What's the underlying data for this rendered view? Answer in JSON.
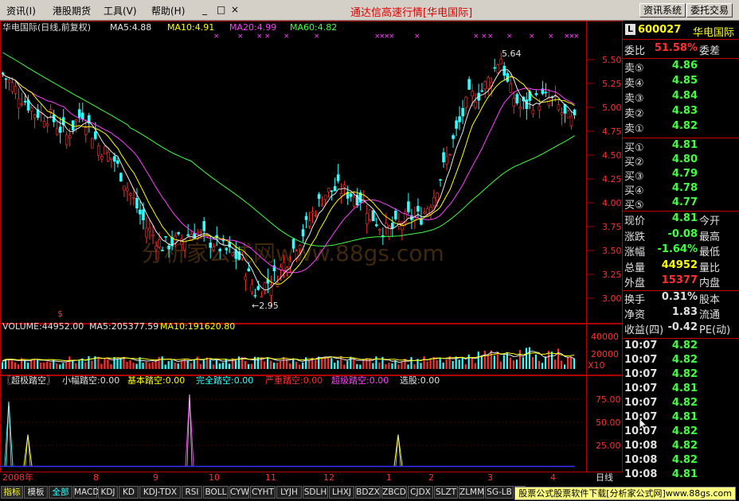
{
  "menubar": {
    "items": [
      "资讯(I)",
      "港股期货",
      "工具(V)",
      "帮助(H)",
      "_",
      "□",
      "×"
    ],
    "title": "通达信高速行情[华电国际]",
    "buttons": [
      "资讯系统",
      "委托交易"
    ]
  },
  "chart_header": {
    "name": "华电国际(日线,前复权)",
    "ma5": "MA5:4.88",
    "ma10": "MA10:4.91",
    "ma20": "MA20:4.99",
    "ma60": "MA60:4.82"
  },
  "price_axis": [
    "5.50",
    "5.25",
    "5.00",
    "4.75",
    "4.50",
    "4.25",
    "4.00",
    "3.75",
    "3.50",
    "3.25",
    "3.00"
  ],
  "annotations": {
    "high": "5.64",
    "low": "←2.95"
  },
  "watermark": "分析家公式网www.88gs.com",
  "volume_header": {
    "volume": "VOLUME:44952.00",
    "ma5": "MA5:205377.59",
    "ma10": "MA10:191620.80"
  },
  "volume_axis": [
    "40000",
    "20000",
    "X10"
  ],
  "indicator_header": {
    "name": "〖超极踏空〗",
    "small": "小幅踏空:0.00",
    "basic": "基本踏空:0.00",
    "full": "完全踏空:0.00",
    "severe": "严重踏空:0.00",
    "super": "超级踏空:0.00",
    "pick": "选股:0.00"
  },
  "indicator_axis": [
    "75.00",
    "50.00",
    "25.00"
  ],
  "time_axis": {
    "year": "2008年",
    "months": [
      "8",
      "9",
      "10",
      "11",
      "12",
      "1",
      "2",
      "3",
      "4"
    ],
    "period": "日线"
  },
  "colors": {
    "up": "#ff3030",
    "down": "#30ffff",
    "ma5": "#e8e8e8",
    "ma10": "#ffff00",
    "ma20": "#ff40ff",
    "ma60": "#40ff40",
    "grid": "#b00000"
  },
  "quote": {
    "code": "600027",
    "name": "华电国际",
    "ratio_label": "委比",
    "ratio": "51.58%",
    "diff_label": "委差",
    "asks": [
      {
        "label": "卖⑤",
        "price": "4.86"
      },
      {
        "label": "卖④",
        "price": "4.85"
      },
      {
        "label": "卖③",
        "price": "4.84"
      },
      {
        "label": "卖②",
        "price": "4.83"
      },
      {
        "label": "卖①",
        "price": "4.82"
      }
    ],
    "bids": [
      {
        "label": "买①",
        "price": "4.81"
      },
      {
        "label": "买②",
        "price": "4.80"
      },
      {
        "label": "买③",
        "price": "4.79"
      },
      {
        "label": "买④",
        "price": "4.78"
      },
      {
        "label": "买⑤",
        "price": "4.77"
      }
    ],
    "stats": [
      {
        "label": "现价",
        "value": "4.81",
        "label2": "今开",
        "color": "#40ff40"
      },
      {
        "label": "涨跌",
        "value": "-0.08",
        "label2": "最高",
        "color": "#40ff40"
      },
      {
        "label": "涨幅",
        "value": "-1.64%",
        "label2": "最低",
        "color": "#40ff40"
      },
      {
        "label": "总量",
        "value": "44952",
        "label2": "量比",
        "color": "#ffff00"
      },
      {
        "label": "外盘",
        "value": "15377",
        "label2": "内盘",
        "color": "#ff3030"
      }
    ],
    "stats2": [
      {
        "label": "换手",
        "value": "0.31%",
        "label2": "股本"
      },
      {
        "label": "净资",
        "value": "1.83",
        "label2": "流通"
      },
      {
        "label": "收益(四)",
        "value": "-0.42",
        "label2": "PE(动)"
      }
    ],
    "ticks": [
      {
        "time": "10:07",
        "price": "4.82"
      },
      {
        "time": "10:07",
        "price": "4.82"
      },
      {
        "time": "10:07",
        "price": "4.82"
      },
      {
        "time": "10:07",
        "price": "4.81"
      },
      {
        "time": "10:07",
        "price": "4.82"
      },
      {
        "time": "10:07",
        "price": "4.81"
      },
      {
        "time": "10:07",
        "price": "4.82"
      },
      {
        "time": "10:08",
        "price": "4.82"
      },
      {
        "time": "10:08",
        "price": "4.82"
      },
      {
        "time": "10:08",
        "price": "4.81"
      }
    ]
  },
  "tabs": [
    "指标",
    "模板",
    "全部",
    "MACD",
    "KDJ",
    "KD",
    "KDJ-TDX",
    "RSI",
    "BOLL",
    "CYW",
    "CYHT",
    "LYJH",
    "SDLH",
    "LHXJ",
    "BDZX",
    "ZBCD",
    "CJDX",
    "SLZT",
    "ZLMM",
    "SG-LB",
    "A"
  ],
  "ad": "股票公式股票软件下载[分析家公式网]www.88gs.com"
}
